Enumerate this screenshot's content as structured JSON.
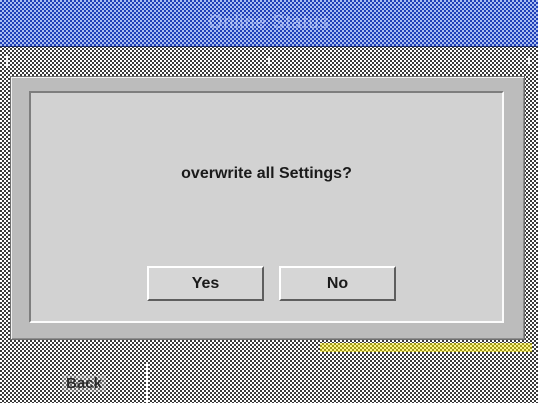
{
  "header": {
    "title": "Online Status"
  },
  "dialog": {
    "message": "overwrite all Settings?",
    "yes_label": "Yes",
    "no_label": "No"
  },
  "footer": {
    "back_label": "Back"
  },
  "colors": {
    "title_bar": "#1f3fb8",
    "dialog_bg": "#d2d2d2",
    "highlight": "#fbf48a"
  }
}
